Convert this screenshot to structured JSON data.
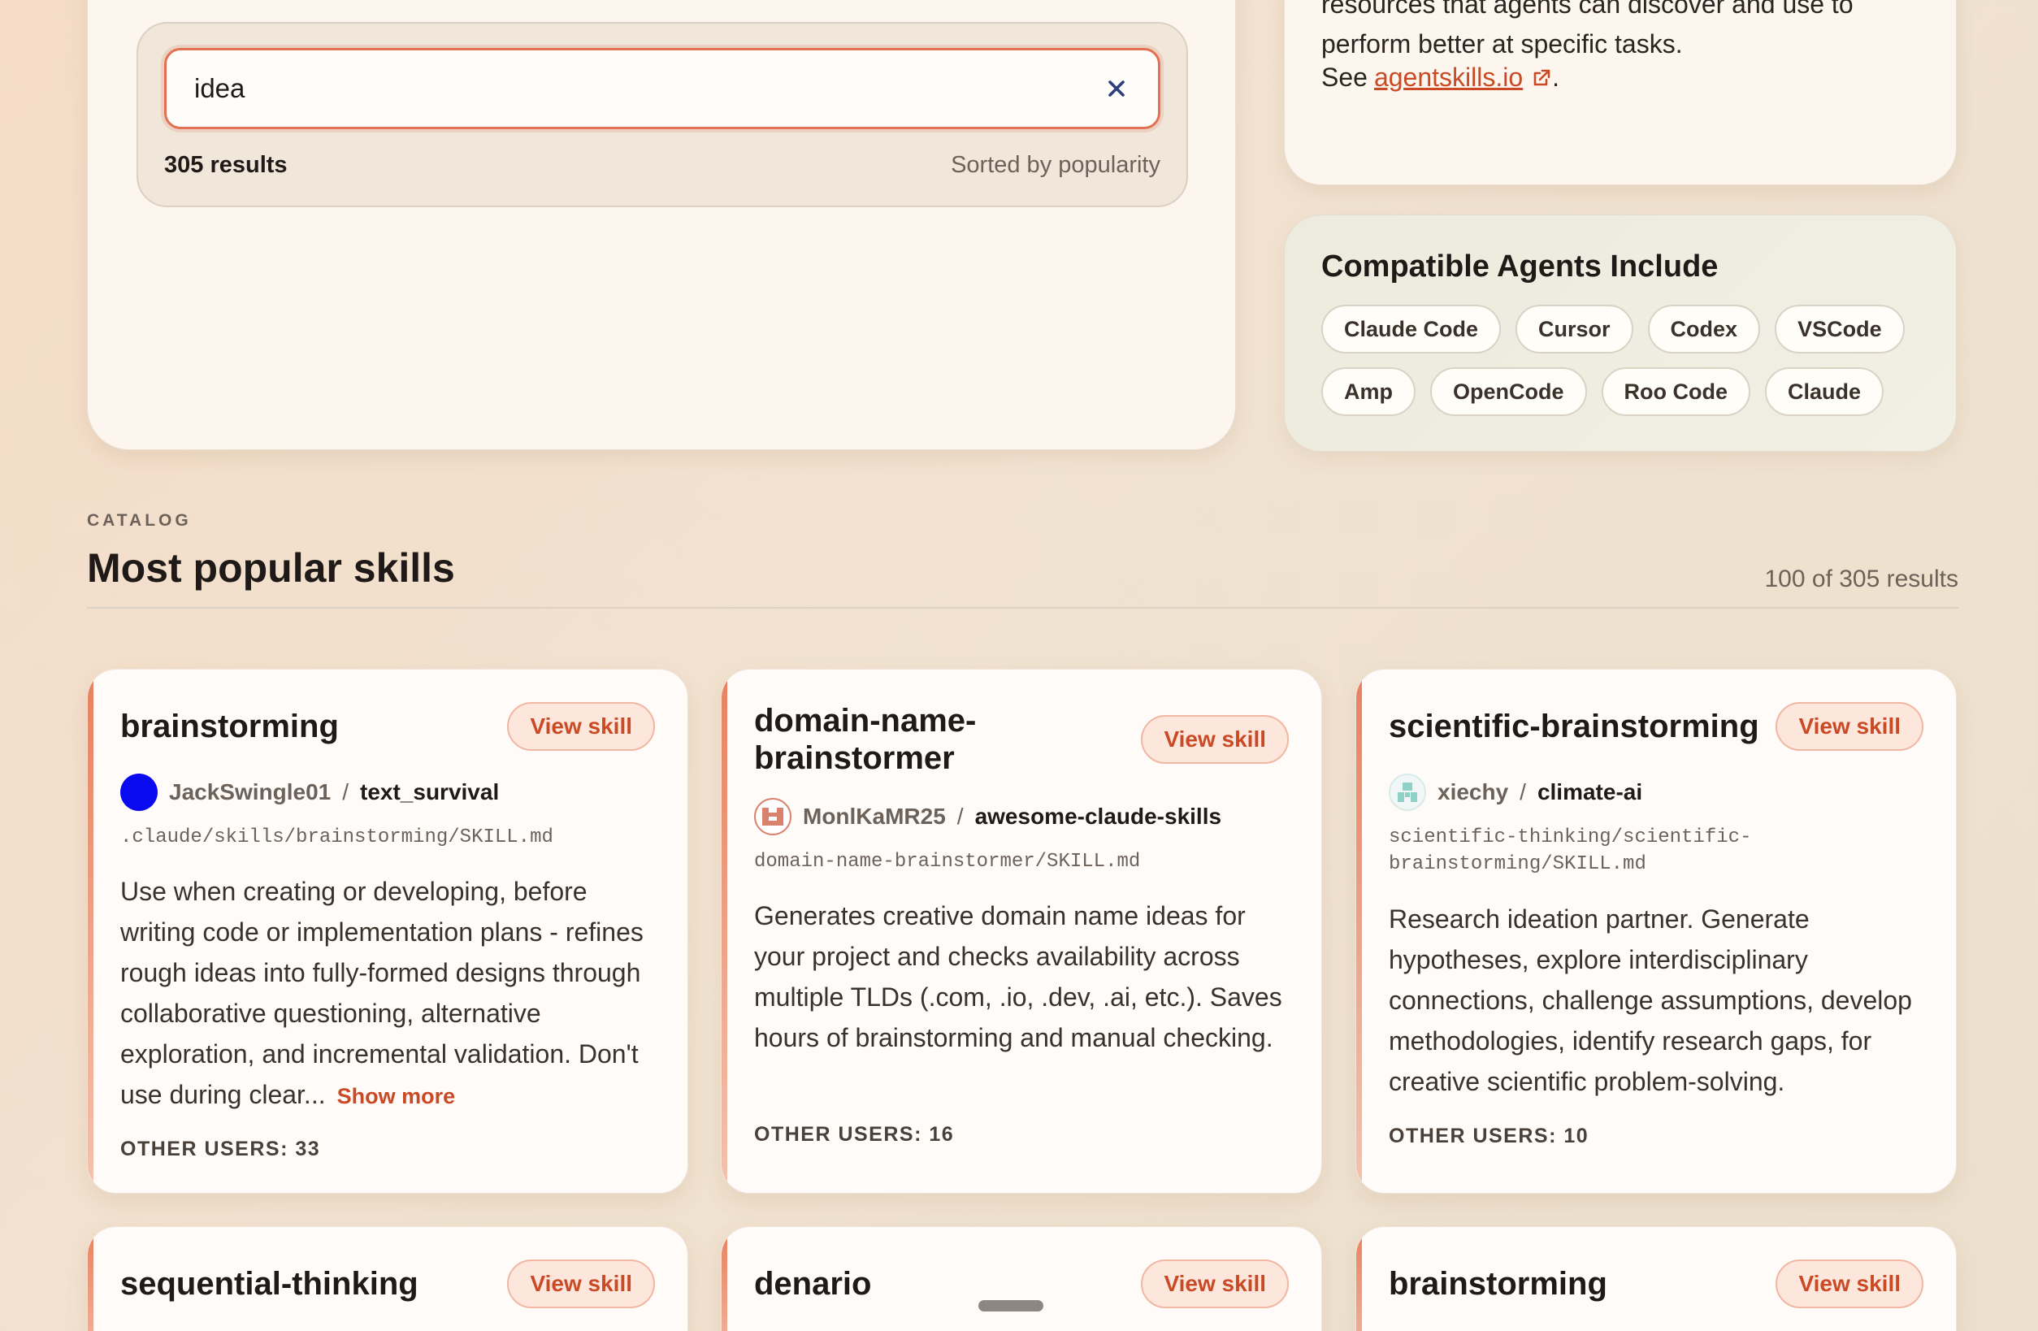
{
  "search": {
    "value": "idea",
    "results_count": "305 results",
    "sort_label": "Sorted by popularity"
  },
  "info": {
    "text": "resources that agents can discover and use to perform better at specific tasks.",
    "see_prefix": "See",
    "link_text": "agentskills.io",
    "suffix": "."
  },
  "agents": {
    "title": "Compatible Agents Include",
    "items": [
      "Claude Code",
      "Cursor",
      "Codex",
      "VSCode",
      "Amp",
      "OpenCode",
      "Roo Code",
      "Claude"
    ]
  },
  "catalog": {
    "eyebrow": "CATALOG",
    "title": "Most popular skills",
    "count": "100 of 305 results"
  },
  "skills": [
    {
      "title": "brainstorming",
      "view_label": "View skill",
      "owner": "JackSwingle01",
      "separator": "/",
      "repo": "text_survival",
      "path": ".claude/skills/brainstorming/SKILL.md",
      "description": "Use when creating or developing, before writing code or implementation plans - refines rough ideas into fully-formed designs through collaborative questioning, alternative exploration, and incremental validation. Don't use during clear...",
      "show_more": "Show more",
      "other_users": "OTHER USERS: 33",
      "avatar_color": "#0a0af0"
    },
    {
      "title": "domain-name-brainstormer",
      "view_label": "View skill",
      "owner": "MonlKaMR25",
      "separator": "/",
      "repo": "awesome-claude-skills",
      "path": "domain-name-brainstormer/SKILL.md",
      "description": "Generates creative domain name ideas for your project and checks availability across multiple TLDs (.com, .io, .dev, .ai, etc.). Saves hours of brainstorming and manual checking.",
      "other_users": "OTHER USERS: 16",
      "avatar_color": "#d9826d"
    },
    {
      "title": "scientific-brainstorming",
      "view_label": "View skill",
      "owner": "xiechy",
      "separator": "/",
      "repo": "climate-ai",
      "path": "scientific-thinking/scientific-brainstorming/SKILL.md",
      "description": "Research ideation partner. Generate hypotheses, explore interdisciplinary connections, challenge assumptions, develop methodologies, identify research gaps, for creative scientific problem-solving.",
      "other_users": "OTHER USERS: 10",
      "avatar_color": "#8fd1c7"
    },
    {
      "title": "sequential-thinking",
      "view_label": "View skill"
    },
    {
      "title": "denario",
      "view_label": "View skill"
    },
    {
      "title": "brainstorming",
      "view_label": "View skill"
    }
  ],
  "colors": {
    "accent": "#c94a24",
    "accent_soft": "#fde7dc",
    "search_border": "#e07253"
  },
  "icons": {
    "clear": "close-icon",
    "external": "external-link-icon"
  }
}
